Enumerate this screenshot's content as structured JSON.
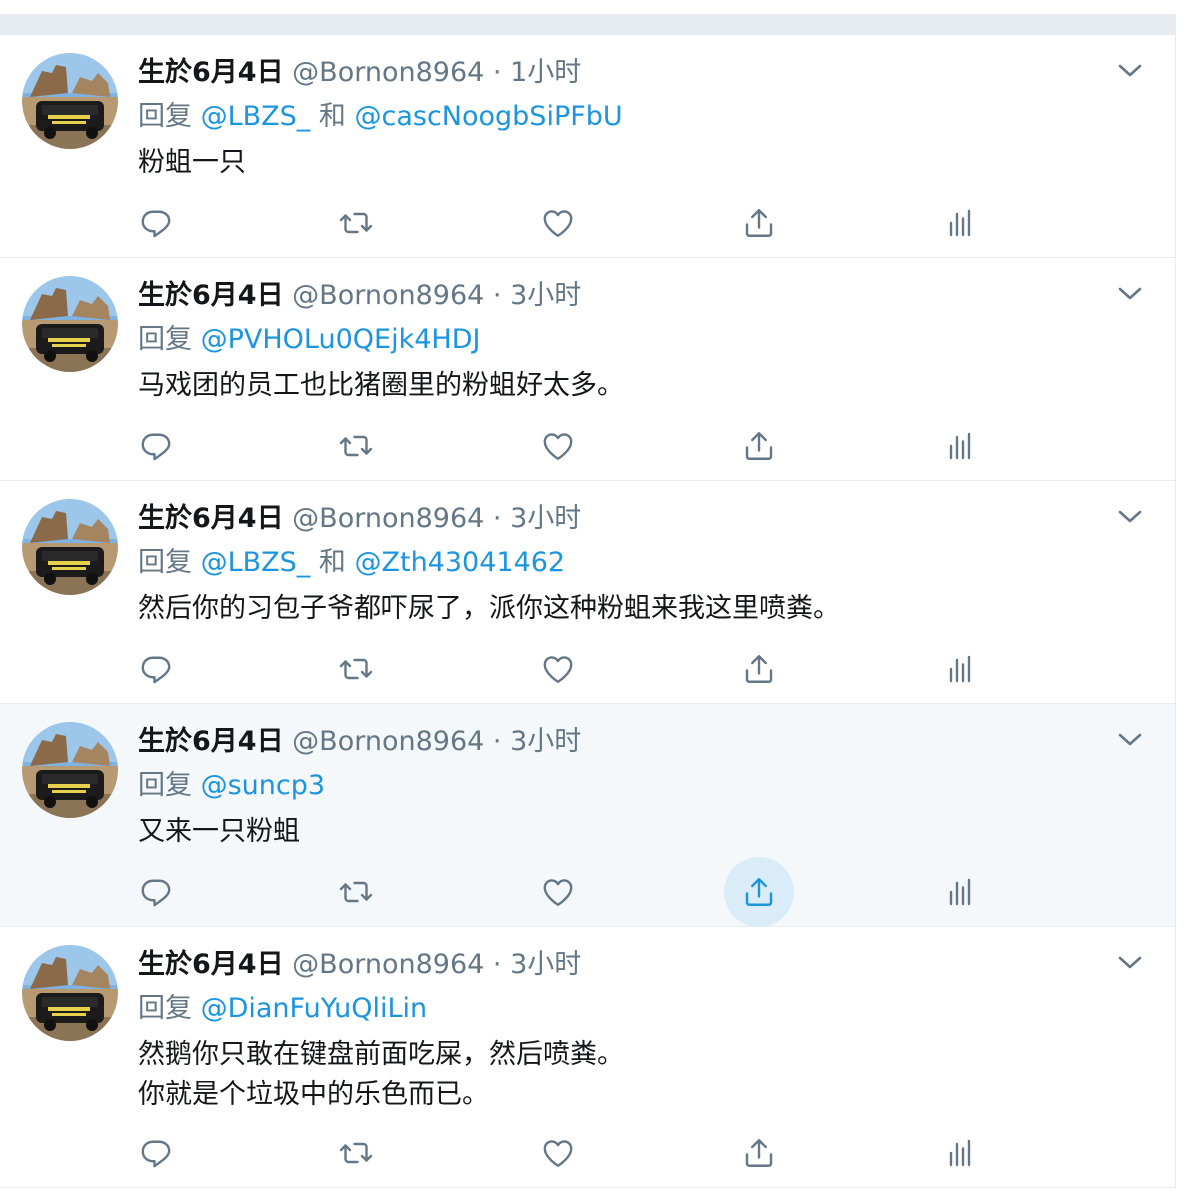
{
  "colors": {
    "accent": "#1b95e0",
    "secondary_text": "#657786",
    "divider": "#e6ecf0",
    "hover_bg": "#f5f8fa",
    "share_hover": "#d9ecf8"
  },
  "icons": {
    "reply": "reply-icon",
    "retweet": "retweet-icon",
    "like": "heart-icon",
    "share": "share-icon",
    "analytics": "analytics-icon",
    "menu": "chevron-down-icon"
  },
  "tweets": [
    {
      "name": "生於6月4日",
      "handle": "@Bornon8964",
      "dot": "·",
      "time": "1小时",
      "reply_prefix": "回复",
      "mention1": "@LBZS_",
      "conj": "和",
      "mention2": "@cascNoogbSiPFbU",
      "text_line1": "粉蛆一只",
      "text_line2": ""
    },
    {
      "name": "生於6月4日",
      "handle": "@Bornon8964",
      "dot": "·",
      "time": "3小时",
      "reply_prefix": "回复",
      "mention1": "@PVHOLu0QEjk4HDJ",
      "conj": "",
      "mention2": "",
      "text_line1": "马戏团的员工也比猪圈里的粉蛆好太多。",
      "text_line2": ""
    },
    {
      "name": "生於6月4日",
      "handle": "@Bornon8964",
      "dot": "·",
      "time": "3小时",
      "reply_prefix": "回复",
      "mention1": "@LBZS_",
      "conj": "和",
      "mention2": "@Zth43041462",
      "text_line1": "然后你的习包子爷都吓尿了，派你这种粉蛆来我这里喷粪。",
      "text_line2": ""
    },
    {
      "name": "生於6月4日",
      "handle": "@Bornon8964",
      "dot": "·",
      "time": "3小时",
      "reply_prefix": "回复",
      "mention1": "@suncp3",
      "conj": "",
      "mention2": "",
      "text_line1": "又来一只粉蛆",
      "text_line2": ""
    },
    {
      "name": "生於6月4日",
      "handle": "@Bornon8964",
      "dot": "·",
      "time": "3小时",
      "reply_prefix": "回复",
      "mention1": "@DianFuYuQliLin",
      "conj": "",
      "mention2": "",
      "text_line1": "然鹅你只敢在键盘前面吃屎，然后喷粪。",
      "text_line2": "你就是个垃圾中的乐色而已。"
    }
  ]
}
